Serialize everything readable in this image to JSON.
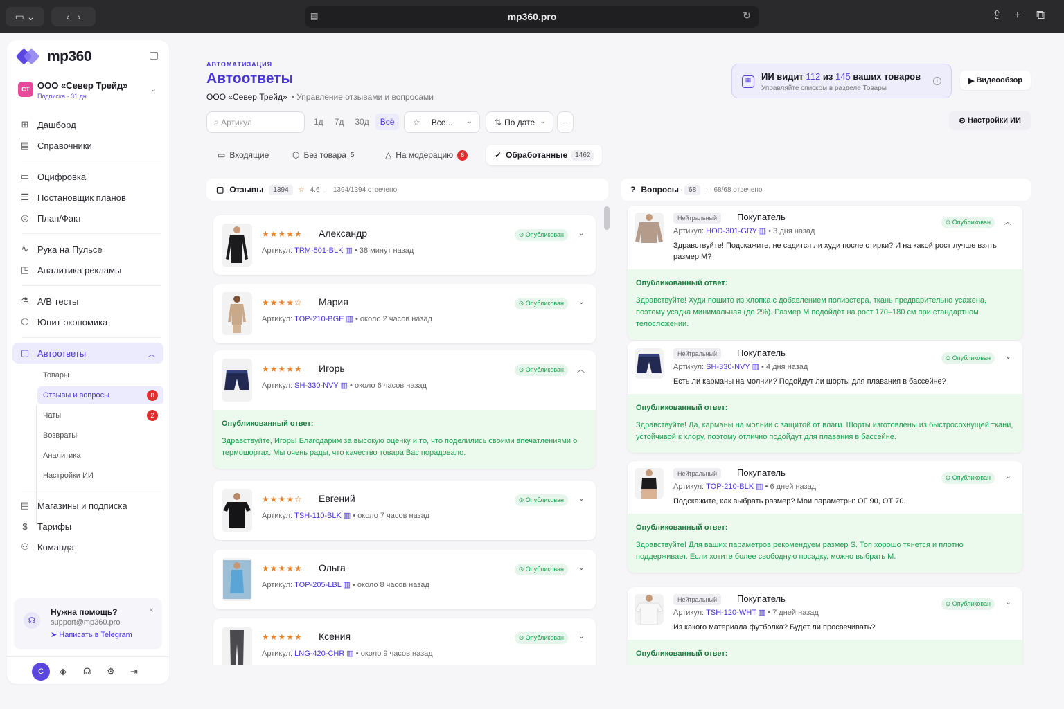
{
  "browser": {
    "url": "mp360.pro"
  },
  "brand": {
    "name": "mp360",
    "accent": "#5b47e0"
  },
  "org": {
    "avatar": "СТ",
    "name": "ООО «Север Трейд»",
    "subscription": "Подписка · 31 дн."
  },
  "nav": {
    "group1": [
      "Дашборд",
      "Справочники"
    ],
    "group2": [
      "Оцифровка",
      "Постановщик планов",
      "План/Факт"
    ],
    "group3": [
      "Рука на Пульсе",
      "Аналитика рекламы"
    ],
    "group4": [
      "A/B тесты",
      "Юнит-экономика"
    ],
    "active": "Автоответы",
    "subitems": [
      {
        "label": "Товары",
        "badge": ""
      },
      {
        "label": "Отзывы и вопросы",
        "badge": "8"
      },
      {
        "label": "Чаты",
        "badge": "2"
      },
      {
        "label": "Возвраты",
        "badge": ""
      },
      {
        "label": "Аналитика",
        "badge": ""
      },
      {
        "label": "Настройки ИИ",
        "badge": ""
      }
    ],
    "group5": [
      "Магазины и подписка",
      "Тарифы",
      "Команда"
    ]
  },
  "help": {
    "title": "Нужна помощь?",
    "email": "support@mp360.pro",
    "telegram": "Написать в Telegram"
  },
  "user": {
    "initial": "C"
  },
  "page": {
    "tag": "АВТОМАТИЗАЦИЯ",
    "title": "Автоответы",
    "org": "ООО «Север Трейд»",
    "desc": "Управление отзывами и вопросами"
  },
  "ai": {
    "prefix": "ИИ видит",
    "seen": "112",
    "mid": "из",
    "total": "145",
    "suffix": "ваших товаров",
    "sub": "Управляйте списком в разделе Товары"
  },
  "video_btn": "Видеообзор",
  "ai_settings_btn": "Настройки ИИ",
  "filters": {
    "search_placeholder": "Артикул",
    "periods": [
      "1д",
      "7д",
      "30д",
      "Всё"
    ],
    "rating": "Все...",
    "sort": "По дате"
  },
  "tabs": [
    {
      "label": "Входящие",
      "count": ""
    },
    {
      "label": "Без товара",
      "count": "5"
    },
    {
      "label": "На модерацию",
      "count": "6"
    },
    {
      "label": "Обработанные",
      "count": "1462"
    }
  ],
  "reviews_panel": {
    "title": "Отзывы",
    "count": "1394",
    "rating": "4.6",
    "answered": "1394/1394 отвечено"
  },
  "questions_panel": {
    "title": "Вопросы",
    "count": "68",
    "answered": "68/68 отвечено"
  },
  "status_published": "Опубликован",
  "answer_label": "Опубликованный ответ:",
  "sku_label": "Артикул:",
  "reviews": [
    {
      "name": "Александр",
      "stars": 5,
      "sku": "TRM-501-BLK",
      "time": "38 минут назад",
      "answer": "",
      "product": "longsleeve-black"
    },
    {
      "name": "Мария",
      "stars": 4,
      "sku": "TOP-210-BGE",
      "time": "около 2 часов назад",
      "answer": "",
      "product": "top-beige"
    },
    {
      "name": "Игорь",
      "stars": 5,
      "sku": "SH-330-NVY",
      "time": "около 6 часов назад",
      "answer": "Здравствуйте, Игорь! Благодарим за высокую оценку и то, что поделились своими впечатлениями о термошортах. Мы очень рады, что качество товара Вас порадовало.",
      "product": "shorts-navy"
    },
    {
      "name": "Евгений",
      "stars": 4,
      "sku": "TSH-110-BLK",
      "time": "около 7 часов назад",
      "answer": "",
      "product": "tshirt-black"
    },
    {
      "name": "Ольга",
      "stars": 5,
      "sku": "TOP-205-LBL",
      "time": "около 8 часов назад",
      "answer": "",
      "product": "tank-blue"
    },
    {
      "name": "Ксения",
      "stars": 5,
      "sku": "LNG-420-CHR",
      "time": "около 9 часов назад",
      "answer": "",
      "product": "leggings-charcoal"
    }
  ],
  "questions": [
    {
      "sentiment": "Нейтральный",
      "author": "Покупатель",
      "sku": "HOD-301-GRY",
      "time": "3 дня назад",
      "text": "Здравствуйте! Подскажите, не садится ли худи после стирки? И на какой рост лучше взять размер M?",
      "answer": "Здравствуйте! Худи пошито из хлопка с добавлением полиэстера, ткань предварительно усажена, поэтому усадка минимальная (до 2%). Размер M подойдёт на рост 170–180 см при стандартном телосложении.",
      "product": "hoodie-grey"
    },
    {
      "sentiment": "Нейтральный",
      "author": "Покупатель",
      "sku": "SH-330-NVY",
      "time": "4 дня назад",
      "text": "Есть ли карманы на молнии? Подойдут ли шорты для плавания в бассейне?",
      "answer": "Здравствуйте! Да, карманы на молнии с защитой от влаги. Шорты изготовлены из быстросохнущей ткани, устойчивой к хлору, поэтому отлично подойдут для плавания в бассейне.",
      "product": "shorts-navy"
    },
    {
      "sentiment": "Нейтральный",
      "author": "Покупатель",
      "sku": "TOP-210-BLK",
      "time": "6 дней назад",
      "text": "Подскажите, как выбрать размер? Мои параметры: ОГ 90, ОТ 70.",
      "answer": "Здравствуйте! Для ваших параметров рекомендуем размер S. Топ хорошо тянется и плотно поддерживает. Если хотите более свободную посадку, можно выбрать M.",
      "product": "top-black"
    },
    {
      "sentiment": "Нейтральный",
      "author": "Покупатель",
      "sku": "TSH-120-WHT",
      "time": "7 дней назад",
      "text": "Из какого материала футболка? Будет ли просвечивать?",
      "answer": "",
      "product": "tshirt-white"
    }
  ]
}
